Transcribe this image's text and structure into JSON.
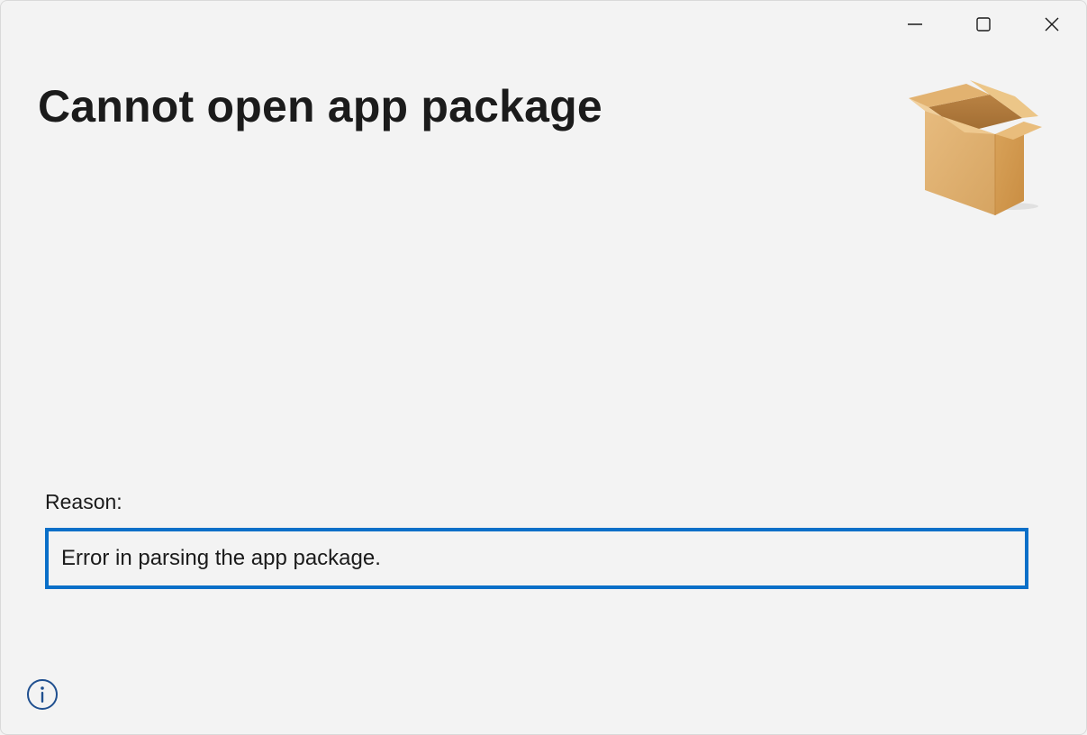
{
  "window": {
    "title": "Cannot open app package",
    "caption_buttons": {
      "minimize_icon": "minimize-icon",
      "maximize_icon": "maximize-icon",
      "close_icon": "close-icon"
    }
  },
  "icon": {
    "name": "package-box-icon"
  },
  "reason": {
    "label": "Reason:",
    "message": "Error in parsing the app package."
  },
  "footer": {
    "info_icon": "info-icon"
  },
  "colors": {
    "background": "#f3f3f3",
    "accent_border": "#0a6fc8",
    "text": "#1b1b1b",
    "info_icon": "#1f4f8f"
  }
}
